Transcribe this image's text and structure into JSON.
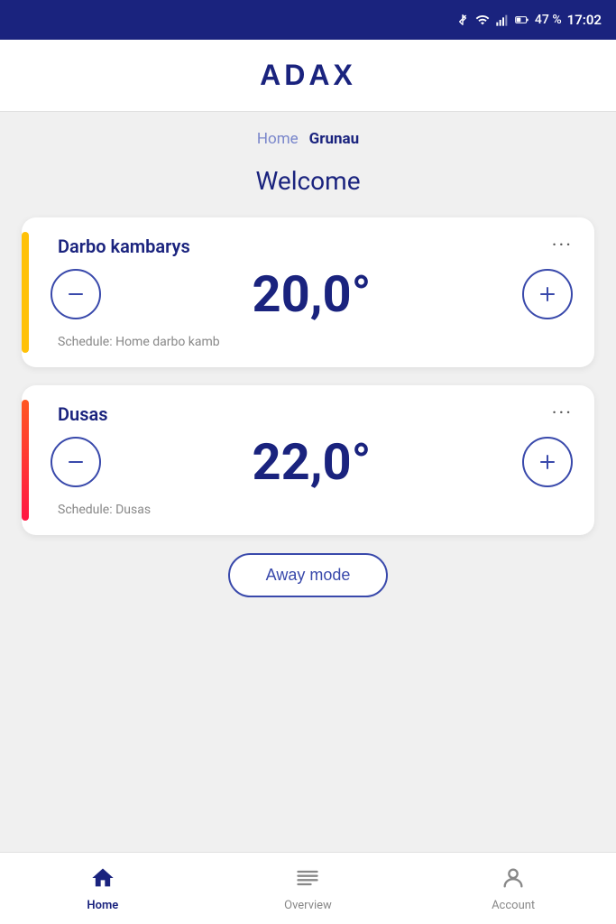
{
  "statusBar": {
    "battery": "47 %",
    "time": "17:02"
  },
  "header": {
    "logo": "ADAX"
  },
  "breadcrumb": {
    "items": [
      {
        "label": "Home",
        "active": false
      },
      {
        "label": "Grunau",
        "active": true
      }
    ]
  },
  "welcome": {
    "title": "Welcome"
  },
  "devices": [
    {
      "id": "darbo",
      "name": "Darbo kambarys",
      "temperature": "20,0°",
      "schedule": "Schedule: Home darbo kamb",
      "indicatorColor": "yellow"
    },
    {
      "id": "dusas",
      "name": "Dusas",
      "temperature": "22,0°",
      "schedule": "Schedule: Dusas",
      "indicatorColor": "orange-red"
    }
  ],
  "awayMode": {
    "label": "Away mode"
  },
  "bottomNav": {
    "items": [
      {
        "id": "home",
        "label": "Home",
        "active": true
      },
      {
        "id": "overview",
        "label": "Overview",
        "active": false
      },
      {
        "id": "account",
        "label": "Account",
        "active": false
      }
    ]
  }
}
